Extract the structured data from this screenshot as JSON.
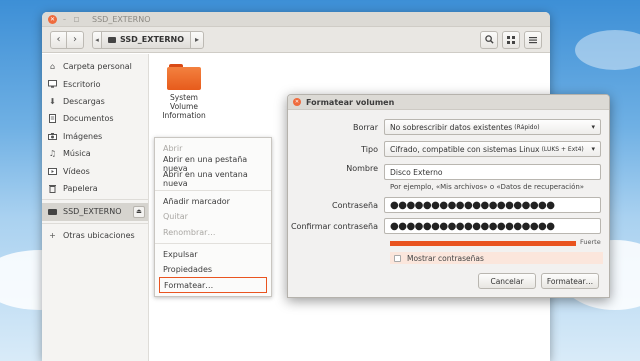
{
  "window": {
    "title": "SSD_EXTERNO",
    "path": "SSD_EXTERNO"
  },
  "sidebar": {
    "items": [
      {
        "label": "Carpeta personal",
        "icon": "home-icon"
      },
      {
        "label": "Escritorio",
        "icon": "desktop-icon"
      },
      {
        "label": "Descargas",
        "icon": "download-icon"
      },
      {
        "label": "Documentos",
        "icon": "document-icon"
      },
      {
        "label": "Imágenes",
        "icon": "camera-icon"
      },
      {
        "label": "Música",
        "icon": "music-icon"
      },
      {
        "label": "Vídeos",
        "icon": "video-icon"
      },
      {
        "label": "Papelera",
        "icon": "trash-icon"
      }
    ],
    "device": {
      "label": "SSD_EXTERNO",
      "icon": "drive-icon"
    },
    "other": {
      "label": "Otras ubicaciones",
      "icon": "plus-icon"
    }
  },
  "folder": {
    "label": "System Volume Information"
  },
  "context_menu": {
    "items": [
      {
        "label": "Abrir",
        "enabled": false
      },
      {
        "label": "Abrir en una pestaña nueva",
        "enabled": true
      },
      {
        "label": "Abrir en una ventana nueva",
        "enabled": true
      },
      {
        "label": "Añadir marcador",
        "enabled": true
      },
      {
        "label": "Quitar",
        "enabled": false
      },
      {
        "label": "Renombrar…",
        "enabled": false
      },
      {
        "label": "Expulsar",
        "enabled": true
      },
      {
        "label": "Propiedades",
        "enabled": true
      },
      {
        "label": "Formatear…",
        "enabled": true,
        "highlighted": true
      }
    ]
  },
  "dialog": {
    "title": "Formatear volumen",
    "erase_label": "Borrar",
    "erase_value": "No sobrescribir datos existentes",
    "erase_note": "(Rápido)",
    "type_label": "Tipo",
    "type_value": "Cifrado, compatible con sistemas Linux",
    "type_note": "(LUKS + Ext4)",
    "name_label": "Nombre",
    "name_value": "Disco Externo",
    "name_hint": "Por ejemplo, «Mis archivos» o «Datos de recuperación»",
    "password_label": "Contraseña",
    "password_value": "●●●●●●●●●●●●●●●●●●●●",
    "confirm_label": "Confirmar contraseña",
    "confirm_value": "●●●●●●●●●●●●●●●●●●●●",
    "strength_label": "Fuerte",
    "strength_fraction": 1.0,
    "show_passwords_label": "Mostrar contraseñas",
    "show_passwords_checked": false,
    "cancel_label": "Cancelar",
    "format_label": "Formatear…"
  },
  "colors": {
    "accent": "#e95420",
    "folder": "#f07a36"
  }
}
